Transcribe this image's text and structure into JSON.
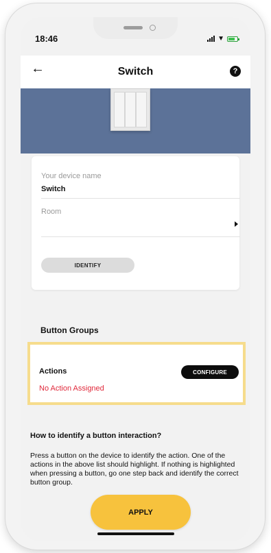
{
  "status_bar": {
    "time": "18:46"
  },
  "header": {
    "title": "Switch",
    "help_glyph": "?"
  },
  "device_card": {
    "name_label": "Your device name",
    "name_value": "Switch",
    "room_label": "Room",
    "identify_label": "IDENTIFY"
  },
  "button_groups": {
    "title": "Button Groups",
    "actions_label": "Actions",
    "configure_label": "CONFIGURE",
    "status_text": "No Action Assigned"
  },
  "help": {
    "heading": "How to identify a button interaction?",
    "text": "Press a button on the device to identify the action. One of the actions in the above list should highlight. If nothing is highlighted when pressing a button, go one step back and identify the correct button group."
  },
  "footer": {
    "apply_label": "APPLY"
  },
  "icons": {
    "back": "back-arrow-icon",
    "help": "help-icon",
    "room_chevron": "chevron-right-icon",
    "signal": "signal-icon",
    "wifi": "wifi-icon",
    "battery": "battery-icon"
  },
  "colors": {
    "hero_background": "#5c7298",
    "highlight_border": "#f6dc8c",
    "apply_button": "#f7c23d",
    "status_error": "#e0283a",
    "configure_button": "#0c0c0c"
  }
}
